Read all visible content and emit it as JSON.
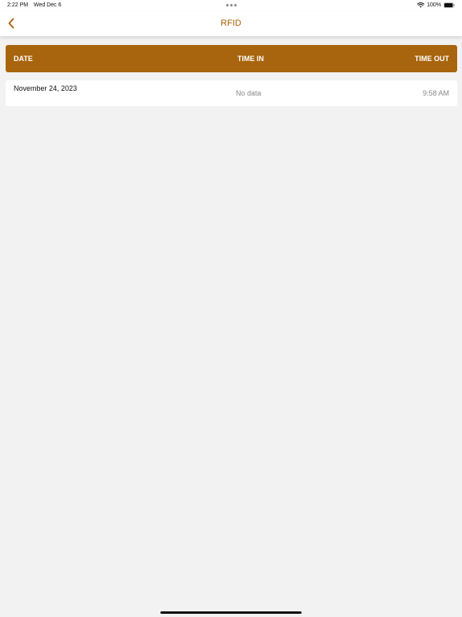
{
  "status_bar": {
    "time": "2:22 PM",
    "date": "Wed Dec 6",
    "battery": "100%"
  },
  "nav": {
    "title": "RFID",
    "back_icon": "chevron-left-icon"
  },
  "colors": {
    "accent": "#a8650d",
    "title": "#a8620a",
    "background": "#f2f2f2"
  },
  "table": {
    "headers": [
      "DATE",
      "TIME IN",
      "TIME OUT"
    ],
    "rows": [
      {
        "date": "November 24, 2023",
        "time_in": "No data",
        "time_out": "9:58 AM"
      }
    ]
  }
}
